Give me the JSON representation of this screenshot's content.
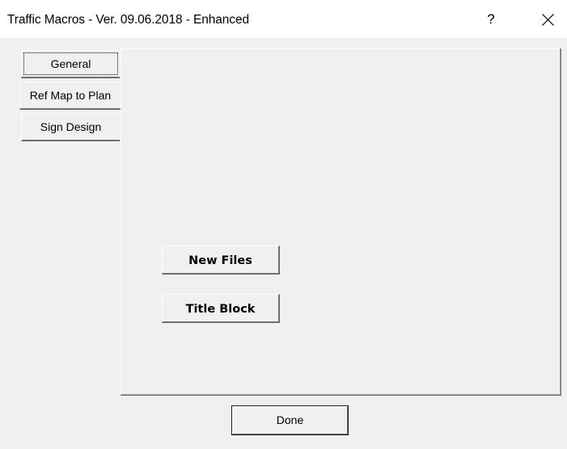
{
  "window": {
    "title": "Traffic Macros - Ver. 09.06.2018 - Enhanced",
    "help_label": "?",
    "close_icon": "close-icon"
  },
  "tabs": [
    {
      "label": "General",
      "selected": true
    },
    {
      "label": "Ref Map to Plan",
      "selected": false
    },
    {
      "label": "Sign Design",
      "selected": false
    }
  ],
  "panel": {
    "new_files_label": "New Files",
    "title_block_label": "Title Block"
  },
  "footer": {
    "done_label": "Done"
  }
}
